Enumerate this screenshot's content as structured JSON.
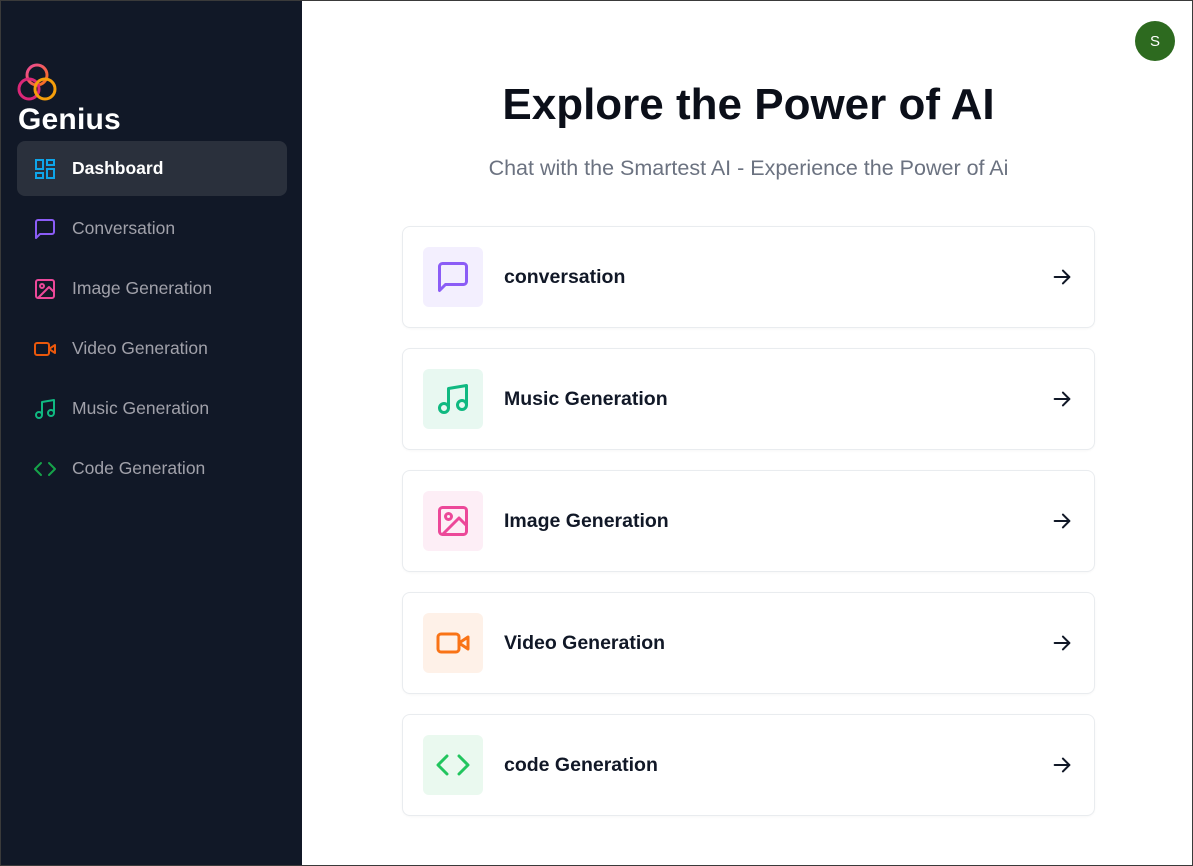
{
  "app": {
    "name": "Genius",
    "logo_icon": "triple-circle-logo-icon",
    "user_avatar_initial": "S",
    "avatar_color": "#2d6a1f"
  },
  "sidebar": {
    "items": [
      {
        "label": "Dashboard",
        "icon": "dashboard-icon",
        "color": "#0ea5e9",
        "active": true
      },
      {
        "label": "Conversation",
        "icon": "message-square-icon",
        "color": "#8b5cf6",
        "active": false
      },
      {
        "label": "Image Generation",
        "icon": "image-icon",
        "color": "#ec4899",
        "active": false
      },
      {
        "label": "Video Generation",
        "icon": "video-icon",
        "color": "#ea580c",
        "active": false
      },
      {
        "label": "Music Generation",
        "icon": "music-icon",
        "color": "#10b981",
        "active": false
      },
      {
        "label": "Code Generation",
        "icon": "code-icon",
        "color": "#16a34a",
        "active": false
      }
    ]
  },
  "main": {
    "title": "Explore the Power of AI",
    "subtitle": "Chat with the Smartest AI - Experience the Power of Ai",
    "cards": [
      {
        "label": "conversation",
        "icon": "message-square-icon",
        "color": "#8b5cf6",
        "bg": "#f3effe"
      },
      {
        "label": "Music Generation",
        "icon": "music-icon",
        "color": "#10b981",
        "bg": "#e8f8f1"
      },
      {
        "label": "Image Generation",
        "icon": "image-icon",
        "color": "#ec4899",
        "bg": "#fdeef6"
      },
      {
        "label": "Video Generation",
        "icon": "video-icon",
        "color": "#f97316",
        "bg": "#fef1e8"
      },
      {
        "label": "code Generation",
        "icon": "code-icon",
        "color": "#22c55e",
        "bg": "#eaf9ef"
      }
    ],
    "arrow_icon": "arrow-right-icon"
  }
}
